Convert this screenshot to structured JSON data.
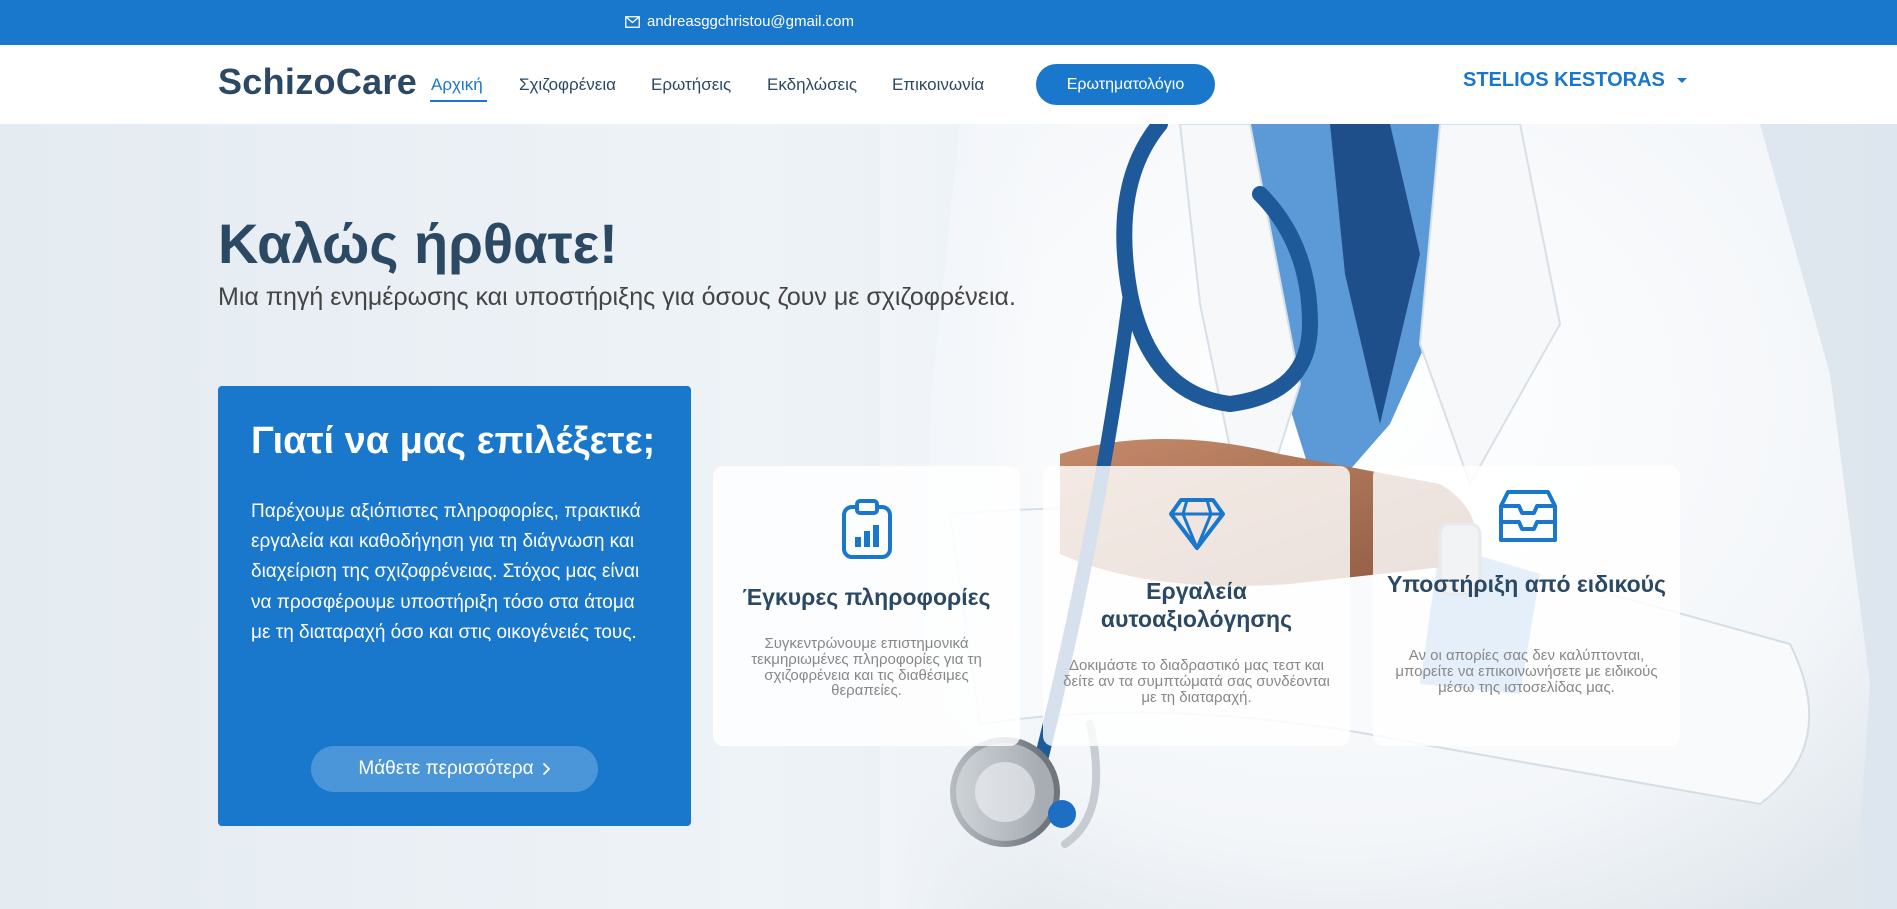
{
  "topbar": {
    "email": "andreasggchristou@gmail.com",
    "mail_icon": "envelope-icon"
  },
  "header": {
    "logo": "SchizoCare",
    "nav": [
      "Αρχική",
      "Σχιζοφρένεια",
      "Ερωτήσεις",
      "Εκδηλώσεις",
      "Επικοινωνία"
    ],
    "active_nav": "Αρχική",
    "cta_label": "Ερωτηματολόγιο",
    "user_name": "STELIOS KESTORAS",
    "user_caret_icon": "caret-down-icon"
  },
  "hero": {
    "title": "Καλώς ήρθατε!",
    "subtitle": "Μια πηγή ενημέρωσης και υποστήριξης για όσους ζουν με σχιζοφρένεια.",
    "background_icon": "doctor-with-stethoscope-photo"
  },
  "why": {
    "title": "Γιατί να μας επιλέξετε;",
    "text": "Παρέχουμε αξιόπιστες πληροφορίες, πρακτικά εργαλεία και καθοδήγηση για τη διάγνωση και διαχείριση της σχιζοφρένειας. Στόχος μας είναι να προσφέρουμε υποστήριξη τόσο στα άτομα με τη διαταραχή όσο και στις οικογένειές τους.",
    "button_label": "Μάθετε περισσότερα",
    "button_icon": "chevron-right-icon"
  },
  "cards": [
    {
      "icon": "clipboard-chart-icon",
      "title": "Έγκυρες πληροφορίες",
      "text": "Συγκεντρώνουμε επιστημονικά τεκμηριωμένες πληροφορίες για τη σχιζοφρένεια και τις διαθέσιμες θεραπείες."
    },
    {
      "icon": "gem-icon",
      "title": "Εργαλεία αυτοαξιολόγησης",
      "text": "Δοκιμάστε το διαδραστικό μας τεστ και δείτε αν τα συμπτώματά σας συνδέονται με τη διαταραχή."
    },
    {
      "icon": "inbox-icon",
      "title": "Υποστήριξη από ειδικούς",
      "text": "Αν οι απορίες σας δεν καλύπτονται, μπορείτε να επικοινωνήσετε με ειδικούς μέσω της ιστοσελίδας μας."
    }
  ],
  "colors": {
    "primary": "#1977cc",
    "heading": "#2c4964",
    "button_light": "#4b95d9"
  }
}
